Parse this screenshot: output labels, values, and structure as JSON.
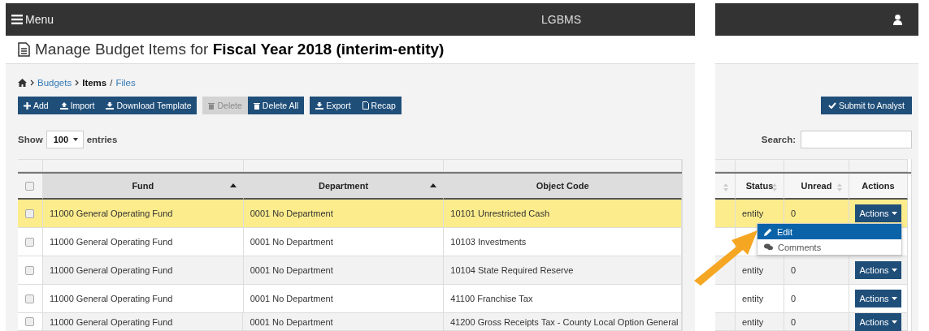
{
  "navbar": {
    "menu_label": "Menu",
    "brand": "LGBMS"
  },
  "title": "Manage Budget Items for **Fiscal Year 2018 (interim-entity)**",
  "breadcrumb": [
    {
      "label": "Budgets",
      "kind": "link"
    },
    {
      "label": "Items",
      "kind": "current"
    },
    {
      "label": "Files",
      "kind": "link",
      "prefix": "/"
    }
  ],
  "toolbar": [
    [
      {
        "label": "Add",
        "disabled": false
      },
      {
        "label": "Import",
        "disabled": false
      },
      {
        "label": "Download Template",
        "disabled": false
      }
    ],
    [
      {
        "label": "Delete",
        "disabled": true
      },
      {
        "label": "Delete All",
        "disabled": false
      }
    ],
    [
      {
        "label": "Export",
        "disabled": false
      },
      {
        "label": "Recap",
        "disabled": false
      }
    ]
  ],
  "submit": {
    "label": "Submit to Analyst"
  },
  "length": {
    "before": "Show",
    "value": "100",
    "after": "entries"
  },
  "search": {
    "label": "Search:"
  },
  "table": {
    "select_all": {
      "checked": false
    },
    "columns_left": [
      {
        "label": "Fund",
        "kind": "sorted"
      },
      {
        "label": "Department",
        "kind": "sorted"
      },
      {
        "label": "Object Code",
        "kind": "plain"
      }
    ],
    "columns_right": [
      {
        "kind": "sortable"
      },
      {
        "label": "Status",
        "kind": "sortable"
      },
      {
        "label": "Unread",
        "kind": "sortable"
      },
      {
        "label": "Actions",
        "kind": "plain"
      }
    ],
    "rows": [
      {
        "selected": true,
        "checked": false,
        "fund": "11000 General Operating Fund",
        "department": "0001 No Department",
        "object_code": "10101 Unrestricted Cash",
        "status": "entity",
        "unread": "0",
        "action": "Actions"
      },
      {
        "selected": false,
        "checked": false,
        "fund": "11000 General Operating Fund",
        "department": "0001 No Department",
        "object_code": "10103 Investments"
      },
      {
        "selected": false,
        "checked": false,
        "fund": "11000 General Operating Fund",
        "department": "0001 No Department",
        "object_code": "10104 State Required Reserve",
        "status": "entity",
        "unread": "0",
        "action": "Actions"
      },
      {
        "selected": false,
        "checked": false,
        "fund": "11000 General Operating Fund",
        "department": "0001 No Department",
        "object_code": "41100 Franchise Tax",
        "status": "entity",
        "unread": "0",
        "action": "Actions"
      },
      {
        "selected": false,
        "checked": false,
        "fund": "11000 General Operating Fund",
        "department": "0001 No Department",
        "object_code": "41200 Gross Receipts Tax - County Local Option General",
        "status": "entity",
        "unread": "0",
        "action": "Actions"
      }
    ]
  },
  "dropdown": {
    "items": [
      {
        "label": "Edit",
        "selected": true
      },
      {
        "label": "Comments",
        "selected": false
      }
    ]
  }
}
